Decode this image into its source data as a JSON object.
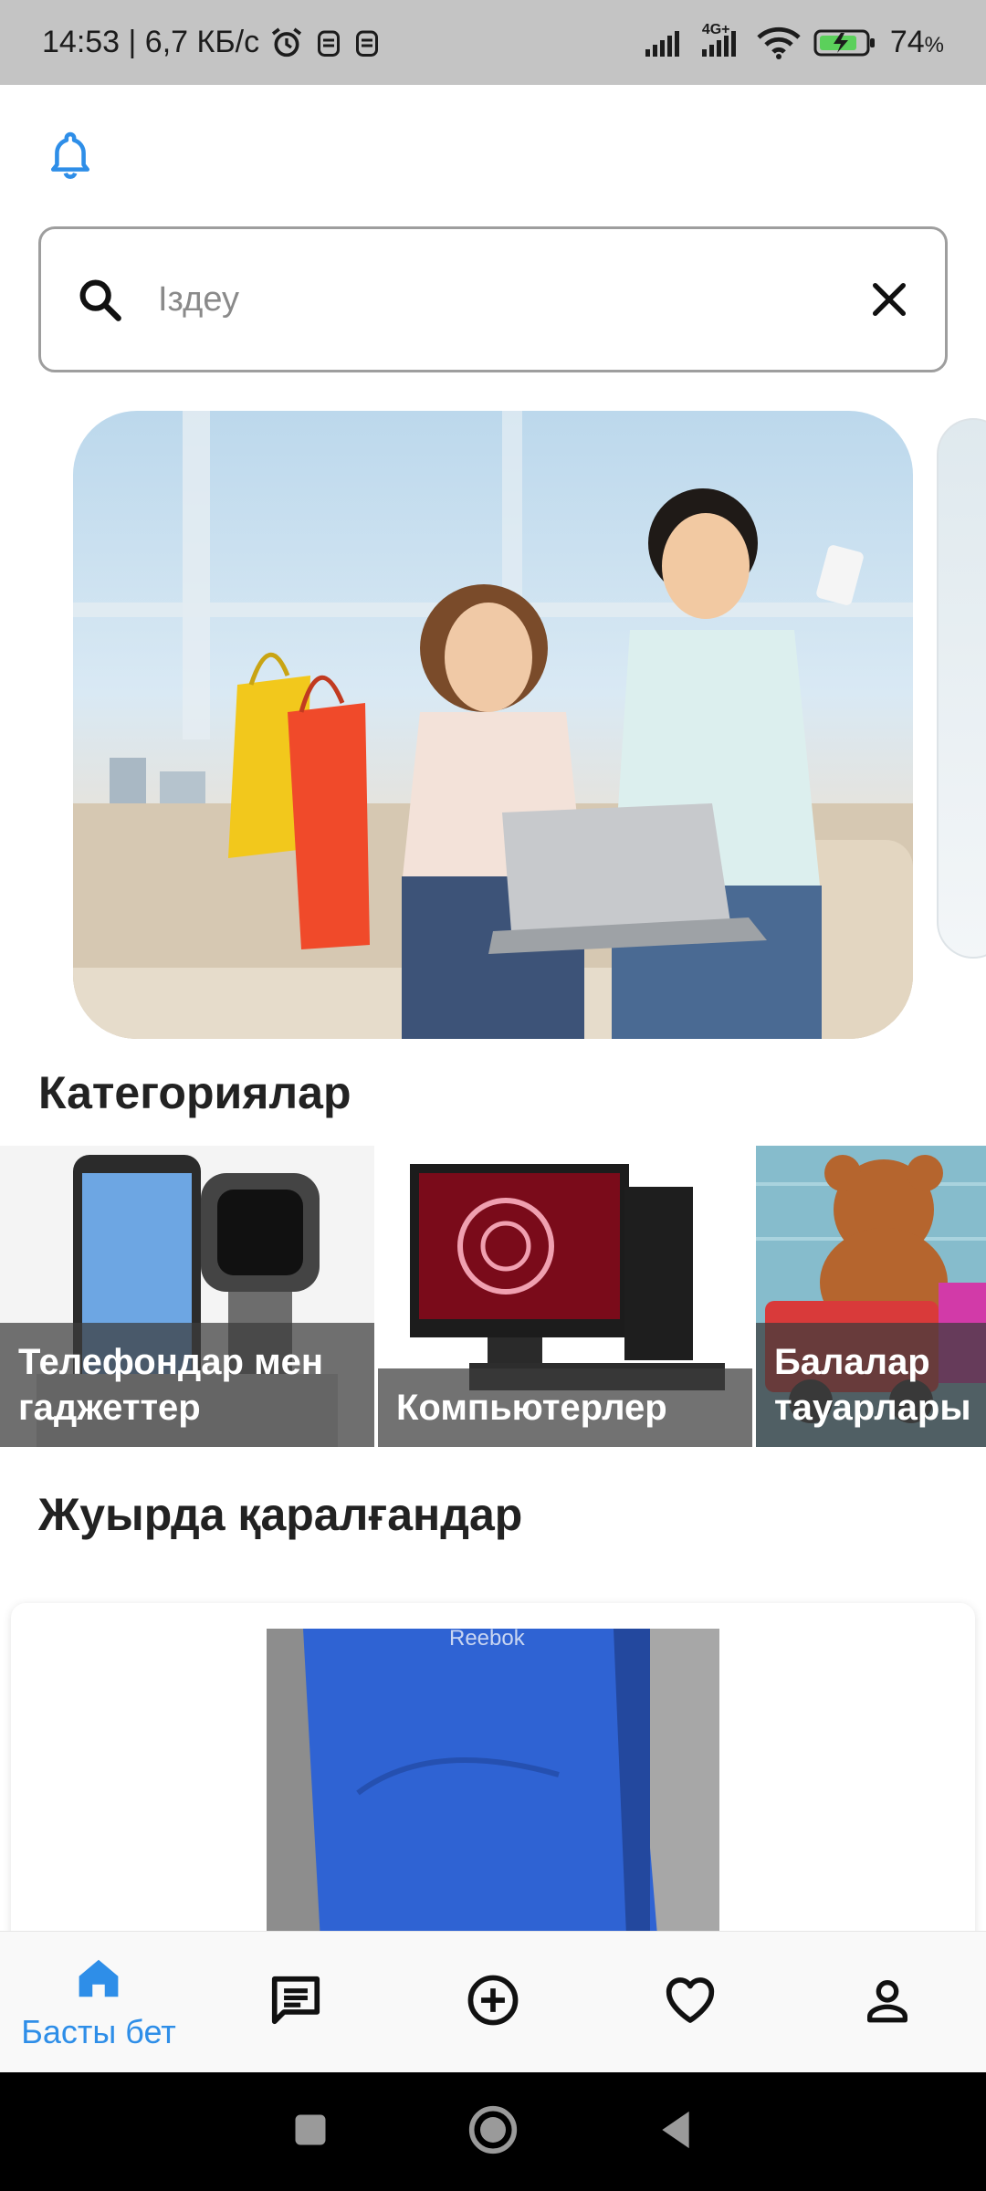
{
  "status_bar": {
    "time_speed": "14:53 | 6,7 КБ/с",
    "network": "4G+",
    "battery": "74",
    "battery_unit": "%"
  },
  "search": {
    "placeholder": "Іздеу",
    "value": ""
  },
  "sections": {
    "categories_title": "Категориялар",
    "recent_title": "Жуырда қаралғандар"
  },
  "categories": [
    {
      "label": "Телефондар мен гаджеттер"
    },
    {
      "label": "Компьютерлер"
    },
    {
      "label": "Балалар тауарлары"
    }
  ],
  "recent": {
    "brand": "Reebok"
  },
  "bottom_nav": {
    "items": [
      {
        "name": "home",
        "label": "Басты бет",
        "active": true
      },
      {
        "name": "messages",
        "label": ""
      },
      {
        "name": "add",
        "label": ""
      },
      {
        "name": "favorites",
        "label": ""
      },
      {
        "name": "profile",
        "label": ""
      }
    ]
  },
  "colors": {
    "accent": "#2e8ee8",
    "status_bar": "#c4c4c4",
    "text": "#212121"
  }
}
